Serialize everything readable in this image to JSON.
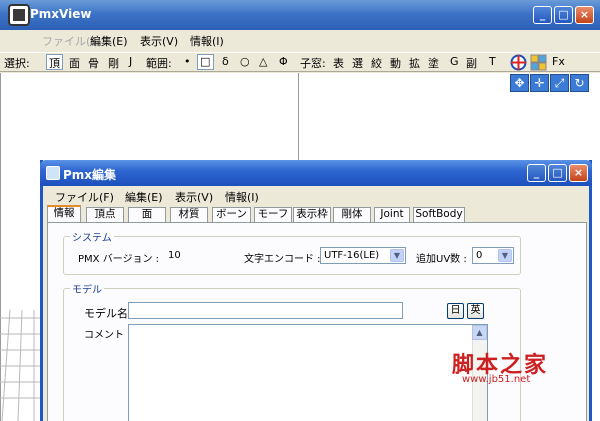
{
  "app": {
    "title": "PmxView",
    "menu": [
      {
        "label": "ファイル(F)",
        "disabled": true
      },
      {
        "label": "編集(E)",
        "disabled": false
      },
      {
        "label": "表示(V)",
        "disabled": false
      },
      {
        "label": "情報(I)",
        "disabled": false
      }
    ],
    "window_buttons": [
      "_",
      "□",
      "×"
    ]
  },
  "toolbar": {
    "select_label": "選択:",
    "select_modes": [
      "頂",
      "面",
      "骨",
      "剛",
      "J"
    ],
    "range_label": "範囲:",
    "range_shapes": [
      "•",
      "□",
      "δ",
      "○",
      "△",
      "Φ"
    ],
    "child_label": "子窓:",
    "child_items": [
      "表",
      "選",
      "絞",
      "動",
      "拡",
      "塗",
      "G",
      "副",
      "T"
    ],
    "fx_label": "Fx"
  },
  "view_tools": [
    "✥",
    "✛",
    "⤢",
    "↻"
  ],
  "dialog": {
    "title": "Pmx編集",
    "menu": [
      "ファイル(F)",
      "編集(E)",
      "表示(V)",
      "情報(I)"
    ],
    "tabs": [
      "情報",
      "頂点",
      "面",
      "材質",
      "ボーン",
      "モーフ",
      "表示枠",
      "剛体",
      "Joint",
      "SoftBody"
    ],
    "active_tab": "情報",
    "system": {
      "group_label": "システム",
      "version_label": "PMX バージョン : ",
      "version_value": "10",
      "encoding_label": "文字エンコード : ",
      "encoding_value": "UTF-16(LE)",
      "uv_label": "追加UV数 :",
      "uv_value": "0"
    },
    "model": {
      "group_label": "モデル",
      "name_label": "モデル名",
      "name_value": "",
      "lang_jp": "日",
      "lang_en": "英",
      "comment_label": "コメント"
    }
  },
  "watermark": {
    "text": "脚本之家",
    "url": "www.jb51.net"
  },
  "colors": {
    "titlebar": "#2d5fb5",
    "dialog_border": "#1f56c9",
    "watermark": "#cc1f1f",
    "active_tab_accent": "#e68b2c"
  }
}
